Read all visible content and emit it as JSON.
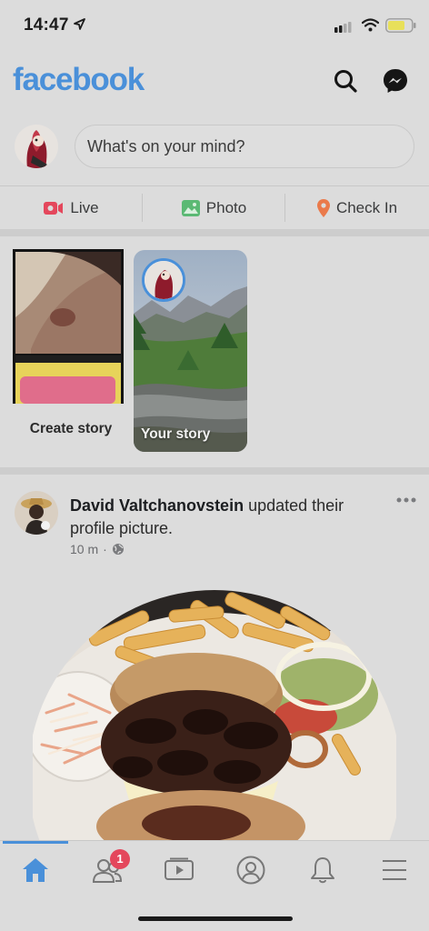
{
  "status_bar": {
    "time": "14:47"
  },
  "header": {
    "logo": "facebook"
  },
  "composer": {
    "placeholder": "What's on your mind?"
  },
  "actions": [
    {
      "label": "Live",
      "icon": "live-video-icon",
      "color": "#e4475c"
    },
    {
      "label": "Photo",
      "icon": "photo-icon",
      "color": "#5bb974"
    },
    {
      "label": "Check In",
      "icon": "location-pin-icon",
      "color": "#ea7a4b"
    }
  ],
  "stories": {
    "create_label": "Create story",
    "your_story_label": "Your story"
  },
  "post": {
    "author": "David Valtchanovstein",
    "action_text": " updated their profile picture.",
    "time": "10 m",
    "privacy_icon": "globe-icon"
  },
  "tab_bar": {
    "tabs": [
      "home",
      "friends",
      "watch",
      "profile",
      "notifications",
      "menu"
    ],
    "active": "home",
    "friends_badge": "1"
  },
  "colors": {
    "accent": "#4a90d9",
    "badge": "#e4475c"
  }
}
